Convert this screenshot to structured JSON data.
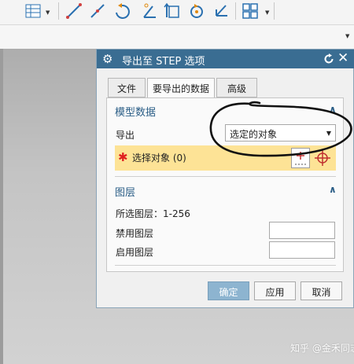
{
  "dialog": {
    "title": "导出至 STEP 选项",
    "tabs": [
      {
        "label": "文件",
        "active": false
      },
      {
        "label": "要导出的数据",
        "active": true
      },
      {
        "label": "高级",
        "active": false
      }
    ],
    "model_section": {
      "title": "模型数据",
      "export_label": "导出",
      "export_value": "选定的对象",
      "select_objects_label": "选择对象 (0)"
    },
    "layer_section": {
      "title": "图层",
      "selectable_layers": "所选图层：1-256",
      "disabled_layers_label": "禁用图层",
      "enabled_layers_label": "启用图层"
    },
    "buttons": {
      "ok": "确定",
      "apply": "应用",
      "cancel": "取消"
    }
  },
  "watermark": "知乎 @金禾同志",
  "colors": {
    "title_bar": "#3a6d92",
    "section_title": "#2a5d86",
    "selection_highlight": "#fde396",
    "primary_button": "#8db4d0",
    "required_star": "#e02020",
    "annotation_stroke": "#111111"
  }
}
